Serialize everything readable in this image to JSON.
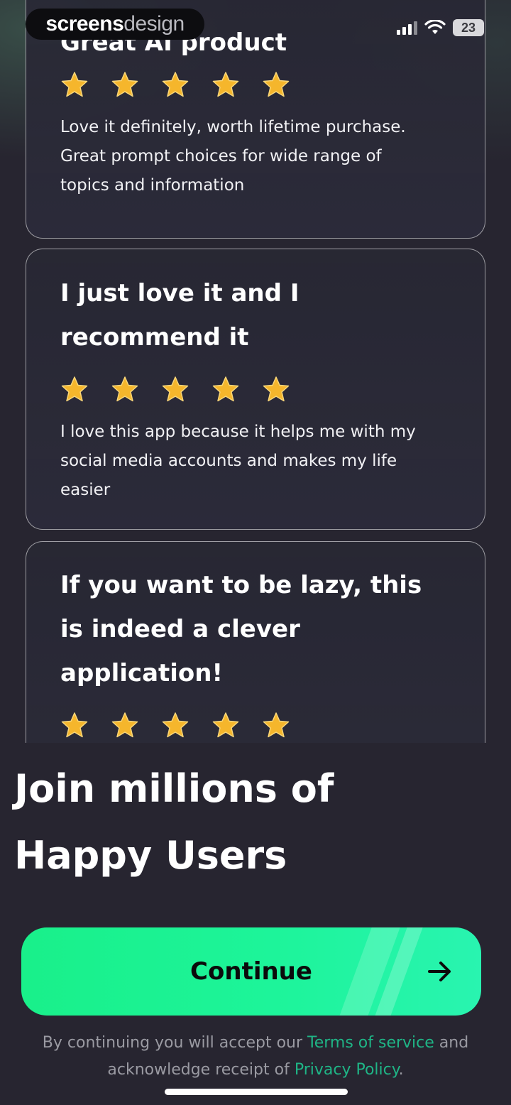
{
  "brand": {
    "part1": "screens",
    "part2": "design"
  },
  "status": {
    "battery": "23"
  },
  "reviews": [
    {
      "title_lines": [
        "Great AI product"
      ],
      "rating": 5,
      "body_lines": [
        "Love it definitely, worth lifetime purchase.",
        "Great prompt choices for wide range of",
        "topics and information"
      ]
    },
    {
      "title_lines": [
        "I just love it and I",
        "recommend it"
      ],
      "rating": 5,
      "body_lines": [
        "I love this app because it helps me with my",
        "social media accounts and makes my life",
        "easier"
      ]
    },
    {
      "title_lines": [
        "If you want to be lazy, this",
        "is indeed a clever",
        "application!"
      ],
      "rating": 5,
      "body_lines": []
    }
  ],
  "headline": {
    "line1": "Join millions of",
    "line2": "Happy Users"
  },
  "continue_button": {
    "label": "Continue"
  },
  "legal": {
    "prefix": "By continuing you will accept our ",
    "terms_link": "Terms of service",
    "middle": " and",
    "line2_prefix": "acknowledge receipt of ",
    "privacy_link": "Privacy Policy",
    "suffix": "."
  },
  "colors": {
    "background": "#272530",
    "accent": "#1df49a",
    "link": "#1fb586",
    "star": "#f5b62c"
  }
}
